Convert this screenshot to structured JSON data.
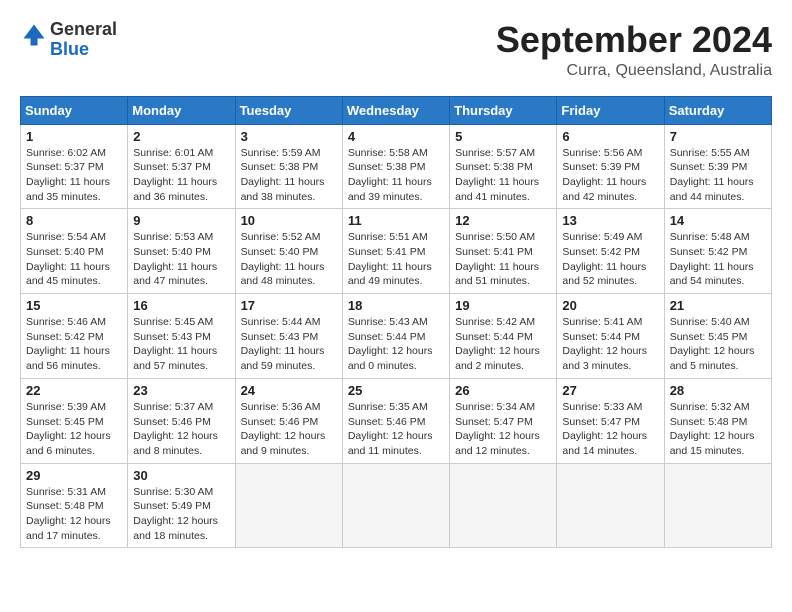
{
  "header": {
    "logo_line1": "General",
    "logo_line2": "Blue",
    "month_year": "September 2024",
    "location": "Curra, Queensland, Australia"
  },
  "weekdays": [
    "Sunday",
    "Monday",
    "Tuesday",
    "Wednesday",
    "Thursday",
    "Friday",
    "Saturday"
  ],
  "weeks": [
    [
      {
        "day": "1",
        "sunrise": "6:02 AM",
        "sunset": "5:37 PM",
        "daylight": "11 hours and 35 minutes."
      },
      {
        "day": "2",
        "sunrise": "6:01 AM",
        "sunset": "5:37 PM",
        "daylight": "11 hours and 36 minutes."
      },
      {
        "day": "3",
        "sunrise": "5:59 AM",
        "sunset": "5:38 PM",
        "daylight": "11 hours and 38 minutes."
      },
      {
        "day": "4",
        "sunrise": "5:58 AM",
        "sunset": "5:38 PM",
        "daylight": "11 hours and 39 minutes."
      },
      {
        "day": "5",
        "sunrise": "5:57 AM",
        "sunset": "5:38 PM",
        "daylight": "11 hours and 41 minutes."
      },
      {
        "day": "6",
        "sunrise": "5:56 AM",
        "sunset": "5:39 PM",
        "daylight": "11 hours and 42 minutes."
      },
      {
        "day": "7",
        "sunrise": "5:55 AM",
        "sunset": "5:39 PM",
        "daylight": "11 hours and 44 minutes."
      }
    ],
    [
      {
        "day": "8",
        "sunrise": "5:54 AM",
        "sunset": "5:40 PM",
        "daylight": "11 hours and 45 minutes."
      },
      {
        "day": "9",
        "sunrise": "5:53 AM",
        "sunset": "5:40 PM",
        "daylight": "11 hours and 47 minutes."
      },
      {
        "day": "10",
        "sunrise": "5:52 AM",
        "sunset": "5:40 PM",
        "daylight": "11 hours and 48 minutes."
      },
      {
        "day": "11",
        "sunrise": "5:51 AM",
        "sunset": "5:41 PM",
        "daylight": "11 hours and 49 minutes."
      },
      {
        "day": "12",
        "sunrise": "5:50 AM",
        "sunset": "5:41 PM",
        "daylight": "11 hours and 51 minutes."
      },
      {
        "day": "13",
        "sunrise": "5:49 AM",
        "sunset": "5:42 PM",
        "daylight": "11 hours and 52 minutes."
      },
      {
        "day": "14",
        "sunrise": "5:48 AM",
        "sunset": "5:42 PM",
        "daylight": "11 hours and 54 minutes."
      }
    ],
    [
      {
        "day": "15",
        "sunrise": "5:46 AM",
        "sunset": "5:42 PM",
        "daylight": "11 hours and 56 minutes."
      },
      {
        "day": "16",
        "sunrise": "5:45 AM",
        "sunset": "5:43 PM",
        "daylight": "11 hours and 57 minutes."
      },
      {
        "day": "17",
        "sunrise": "5:44 AM",
        "sunset": "5:43 PM",
        "daylight": "11 hours and 59 minutes."
      },
      {
        "day": "18",
        "sunrise": "5:43 AM",
        "sunset": "5:44 PM",
        "daylight": "12 hours and 0 minutes."
      },
      {
        "day": "19",
        "sunrise": "5:42 AM",
        "sunset": "5:44 PM",
        "daylight": "12 hours and 2 minutes."
      },
      {
        "day": "20",
        "sunrise": "5:41 AM",
        "sunset": "5:44 PM",
        "daylight": "12 hours and 3 minutes."
      },
      {
        "day": "21",
        "sunrise": "5:40 AM",
        "sunset": "5:45 PM",
        "daylight": "12 hours and 5 minutes."
      }
    ],
    [
      {
        "day": "22",
        "sunrise": "5:39 AM",
        "sunset": "5:45 PM",
        "daylight": "12 hours and 6 minutes."
      },
      {
        "day": "23",
        "sunrise": "5:37 AM",
        "sunset": "5:46 PM",
        "daylight": "12 hours and 8 minutes."
      },
      {
        "day": "24",
        "sunrise": "5:36 AM",
        "sunset": "5:46 PM",
        "daylight": "12 hours and 9 minutes."
      },
      {
        "day": "25",
        "sunrise": "5:35 AM",
        "sunset": "5:46 PM",
        "daylight": "12 hours and 11 minutes."
      },
      {
        "day": "26",
        "sunrise": "5:34 AM",
        "sunset": "5:47 PM",
        "daylight": "12 hours and 12 minutes."
      },
      {
        "day": "27",
        "sunrise": "5:33 AM",
        "sunset": "5:47 PM",
        "daylight": "12 hours and 14 minutes."
      },
      {
        "day": "28",
        "sunrise": "5:32 AM",
        "sunset": "5:48 PM",
        "daylight": "12 hours and 15 minutes."
      }
    ],
    [
      {
        "day": "29",
        "sunrise": "5:31 AM",
        "sunset": "5:48 PM",
        "daylight": "12 hours and 17 minutes."
      },
      {
        "day": "30",
        "sunrise": "5:30 AM",
        "sunset": "5:49 PM",
        "daylight": "12 hours and 18 minutes."
      },
      null,
      null,
      null,
      null,
      null
    ]
  ]
}
